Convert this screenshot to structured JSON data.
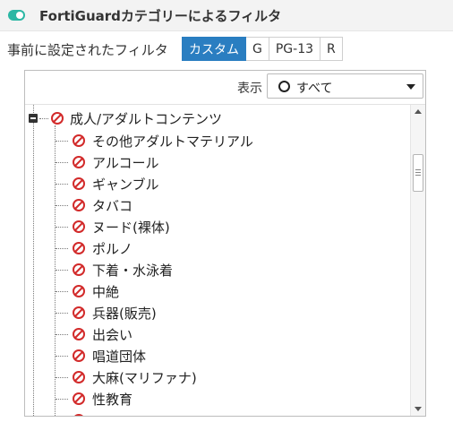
{
  "section": {
    "title": "FortiGuardカテゴリーによるフィルタ",
    "toggle_state": "on",
    "accent_color": "#2bb7a4"
  },
  "presets": {
    "label": "事前に設定されたフィルタ",
    "options": [
      "カスタム",
      "G",
      "PG-13",
      "R"
    ],
    "selected": "カスタム",
    "active_color": "#2a7ec1"
  },
  "toolbar": {
    "view_label": "表示",
    "view_value": "すべて",
    "view_icon": "circle-icon"
  },
  "tree": {
    "parent": {
      "label": "成人/アダルトコンテンツ",
      "expanded": true,
      "action_icon": "block-icon"
    },
    "children": [
      "その他アダルトマテリアル",
      "アルコール",
      "ギャンブル",
      "タバコ",
      "ヌード(裸体)",
      "ポルノ",
      "下着・水泳着",
      "中絶",
      "兵器(販売)",
      "出会い",
      "唱道団体",
      "大麻(マリファナ)",
      "性教育"
    ],
    "block_color": "#d22a2a"
  }
}
